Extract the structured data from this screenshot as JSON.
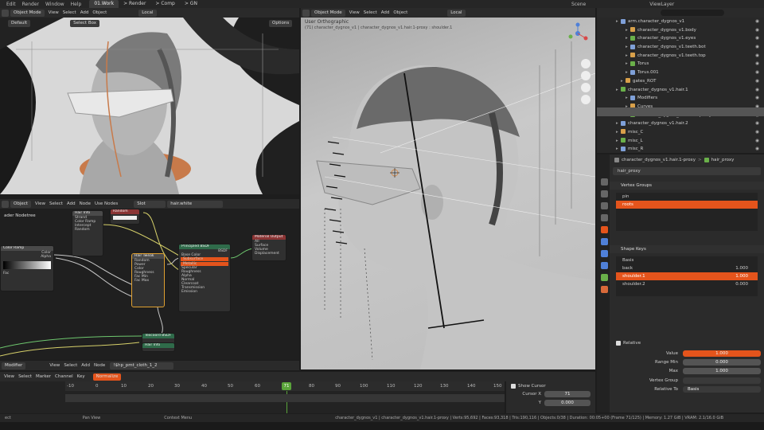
{
  "topbar": {
    "menus": [
      "Edit",
      "Render",
      "Window",
      "Help"
    ],
    "tabs": [
      "01.Work",
      "> Render",
      "> Comp",
      "> GN"
    ],
    "scene_label": "Scene",
    "viewlayer_label": "ViewLayer"
  },
  "viewport_small": {
    "mode": "Object Mode",
    "menus": [
      "View",
      "Select",
      "Add",
      "Object"
    ],
    "transform": "Local",
    "orientation": "Default",
    "select_box": "Select Box",
    "options": "Options"
  },
  "viewport_main": {
    "mode": "Object Mode",
    "menus": [
      "View",
      "Select",
      "Add",
      "Object"
    ],
    "transform": "Local",
    "title": "User Orthographic",
    "subtitle": "(71) character_dygnos_v1 | character_dygnos_v1.hair.1-proxy : shoulder.1"
  },
  "node_editor": {
    "type": "Object",
    "menus": [
      "View",
      "Select",
      "Add",
      "Node"
    ],
    "use_nodes": "Use Nodes",
    "slot": "Slot",
    "material": "hair.white",
    "tree_label": "ader Nodetree",
    "nodes": {
      "n1_title": "Color Ramp",
      "n2_title": "Hair Tweak",
      "n3_title": "Principled BSDF",
      "n4_title": "Material Output",
      "n5_title": "Texcoord BSDF",
      "n6_title": "Hair Info",
      "n1_rows": [
        "Color",
        "Alpha",
        "Fac"
      ],
      "n2_rows": [
        "Random",
        "Power",
        "Color",
        "Roughness",
        "Fac Min",
        "Fac Max"
      ],
      "n3_rows": [
        "BSDF",
        "Base Color",
        "Subsurface",
        "Metallic",
        "Specular",
        "Roughness",
        "Alpha",
        "Normal",
        "Clearcoat",
        "Transmission",
        "Emission"
      ],
      "n4_rows": [
        "All",
        "Surface",
        "Volume",
        "Displacement"
      ],
      "n0_rows": [
        "Strand",
        "Color Ramp",
        "Intercept",
        "Random"
      ],
      "n0_vals": [
        "Random",
        "Color"
      ]
    }
  },
  "bottom_editor": {
    "type": "Modifier",
    "menus": [
      "View",
      "Select",
      "Add",
      "Node"
    ],
    "node_name": "!$hp_pmt_cloth_1_2"
  },
  "timeline": {
    "menus": [
      "View",
      "Select",
      "Marker",
      "Channel",
      "Key"
    ],
    "normalize": "Normalize",
    "ticks": [
      "-10",
      "0",
      "10",
      "20",
      "30",
      "40",
      "50",
      "60",
      "70",
      "80",
      "90",
      "100",
      "110",
      "120",
      "130",
      "140",
      "150"
    ],
    "current_frame": "71",
    "show_cursor": "Show Cursor",
    "cursor_x_label": "Cursor X",
    "cursor_x_value": "71",
    "cursor_y_label": "Y",
    "cursor_y_value": "0.000"
  },
  "outliner": {
    "rows": [
      {
        "label": "arm.character_dygnos_v1",
        "indent": 4
      },
      {
        "label": "character_dygnos_v1.body",
        "indent": 6
      },
      {
        "label": "character_dygnos_v1.eyes",
        "indent": 6
      },
      {
        "label": "character_dygnos_v1.teeth.bot",
        "indent": 6
      },
      {
        "label": "character_dygnos_v1.teeth.top",
        "indent": 6
      },
      {
        "label": "Torus",
        "indent": 6
      },
      {
        "label": "Torus.001",
        "indent": 6
      },
      {
        "label": "gates_ROT",
        "indent": 5
      },
      {
        "label": "character_dygnos_v1.hair.1",
        "indent": 4
      },
      {
        "label": "Modifiers",
        "indent": 6
      },
      {
        "label": "Curves",
        "indent": 6
      },
      {
        "label": "character_dygnos_v1.hair.1-proxy",
        "indent": 6
      },
      {
        "label": "character_dygnos_v1.hair.2",
        "indent": 4
      },
      {
        "label": "misc_C",
        "indent": 4
      },
      {
        "label": "misc_L",
        "indent": 4
      },
      {
        "label": "misc_R",
        "indent": 4
      }
    ]
  },
  "properties": {
    "breadcrumb_obj": "character_dygnos_v1.hair.1-proxy",
    "breadcrumb_data": "hair_proxy",
    "data_name": "hair_proxy",
    "vertex_groups_title": "Vertex Groups",
    "vertex_groups": [
      "pin",
      "roots"
    ],
    "shape_keys_title": "Shape Keys",
    "shape_keys": [
      {
        "name": "Basis",
        "value": ""
      },
      {
        "name": "back",
        "value": "1.000"
      },
      {
        "name": "shoulder.1",
        "value": "1.000"
      },
      {
        "name": "shoulder.2",
        "value": "0.000"
      }
    ],
    "relative": "Relative",
    "value_label": "Value",
    "value": "1.000",
    "range_min_label": "Range Min",
    "range_min": "0.000",
    "max_label": "Max",
    "max": "1.000",
    "vertex_group_label": "Vertex Group",
    "relative_to_label": "Relative To",
    "relative_to": "Basis"
  },
  "statusbar": {
    "left": "ect",
    "pan": "Pan View",
    "context": "Context Menu",
    "stats": "character_dygnos_v1 | character_dygnos_v1.hair.1-proxy | Verts:95,692 | Faces:93,318 | Tris:190,116 | Objects:0/38 | Duration: 00:05+00 (Frame 71/125) | Memory: 1.27 GiB | VRAM: 2.1/16.0 GiB"
  },
  "colors": {
    "accent": "#e4541c",
    "frame_marker": "#5aa43a",
    "node_green": "#2f6b4a",
    "node_red": "#8a3434"
  }
}
